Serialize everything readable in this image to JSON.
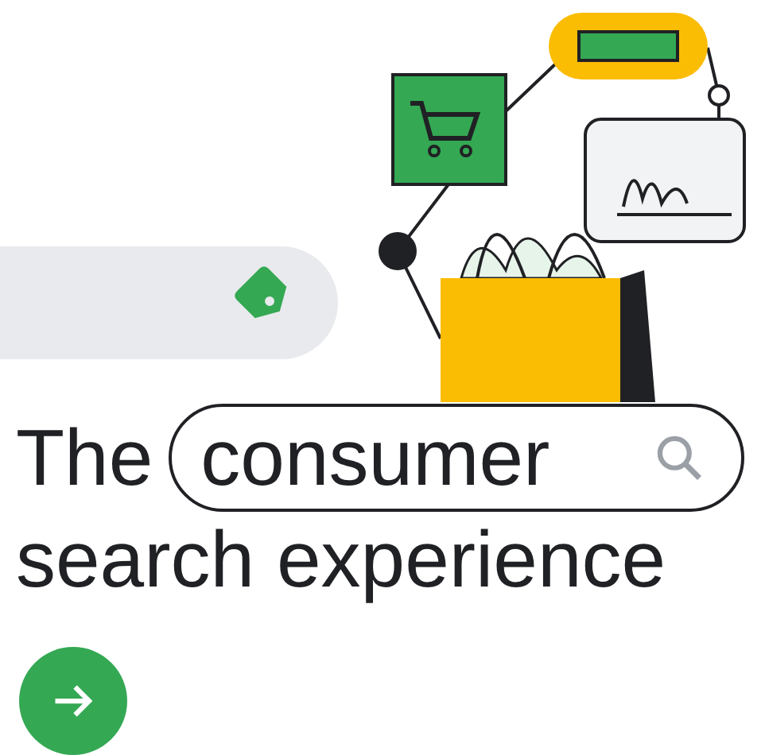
{
  "headline": {
    "line_1_start": "The",
    "search_term": "consumer",
    "line_2": "search experience"
  }
}
